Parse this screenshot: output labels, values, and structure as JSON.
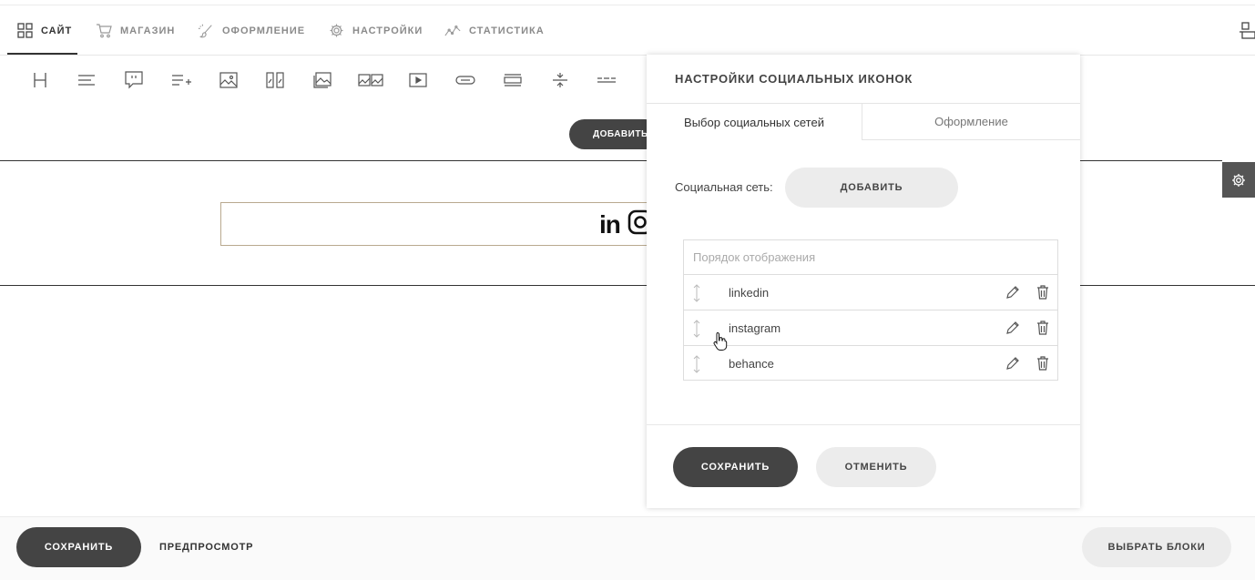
{
  "nav": {
    "items": [
      {
        "label": "САЙТ",
        "icon": "grid-icon"
      },
      {
        "label": "МАГАЗИН",
        "icon": "cart-icon"
      },
      {
        "label": "ОФОРМЛЕНИЕ",
        "icon": "brush-icon"
      },
      {
        "label": "НАСТРОЙКИ",
        "icon": "gear-icon"
      },
      {
        "label": "СТАТИСТИКА",
        "icon": "chart-line-icon"
      }
    ],
    "active_index": 0
  },
  "canvas": {
    "add_label": "ДОБАВИТЬ",
    "social_text": "in"
  },
  "panel": {
    "title": "НАСТРОЙКИ СОЦИАЛЬНЫХ ИКОНОК",
    "tabs": [
      "Выбор социальных сетей",
      "Оформление"
    ],
    "active_tab": 0,
    "social_label": "Социальная сеть:",
    "add_button": "ДОБАВИТЬ",
    "order_header": "Порядок отображения",
    "networks": [
      "linkedin",
      "instagram",
      "behance"
    ],
    "save_button": "СОХРАНИТЬ",
    "cancel_button": "ОТМЕНИТЬ"
  },
  "bottom": {
    "save": "СОХРАНИТЬ",
    "preview": "ПРЕДПРОСМОТР",
    "choose_blocks": "ВЫБРАТЬ БЛОКИ"
  },
  "colors": {
    "dark_button": "#444444",
    "light_button": "#ececec",
    "box_border": "#b9a98f"
  }
}
